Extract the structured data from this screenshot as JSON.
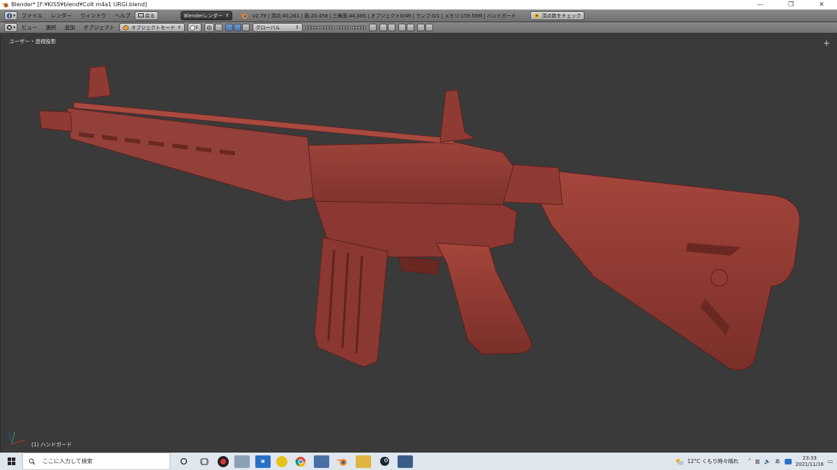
{
  "window": {
    "title": "Blender* [F:¥KISS¥blend¥Colt m4a1 URGI.blend]",
    "minimize": "—",
    "maximize": "❐",
    "close": "✕"
  },
  "header": {
    "menus": [
      "ファイル",
      "レンダー",
      "ウィンドウ",
      "ヘルプ"
    ],
    "back_label": "戻る",
    "render_engine": "Blenderレンダー",
    "stats": "v2.79 | 頂点:40,261 | 面:20,458 | 三角面:44,085 | オブジェクト0/49 | ランプ:0/1 | メモリ:159.58M | ハンドガード",
    "check_vertices_label": "頂点数をチェック"
  },
  "view_header": {
    "menus": [
      "ビュー",
      "選択",
      "追加",
      "オブジェクト"
    ],
    "mode": "オブジェクトモード",
    "orientation": "グローバル"
  },
  "viewport": {
    "label": "ユーザー・透視投影",
    "object_info": "(1) ハンドガード",
    "model_color": "#8a3a33"
  },
  "taskbar": {
    "search_placeholder": "ここに入力して検索",
    "weather": "12°C くもり時々晴れ",
    "ime": "あ",
    "time": "23:33",
    "date": "2021/11/16"
  }
}
